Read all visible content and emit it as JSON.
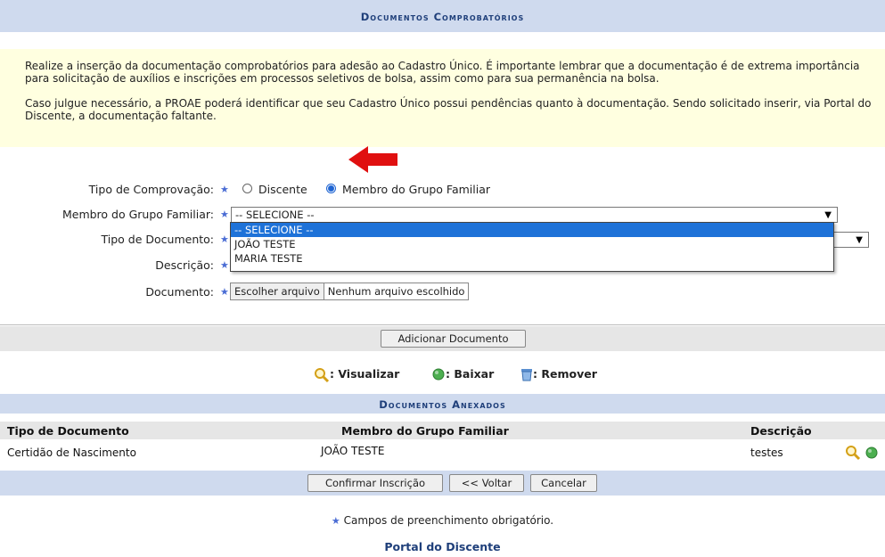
{
  "header": {
    "title": "Documentos Comprobatórios"
  },
  "notice": {
    "p1": "Realize a inserção da documentação comprobatórios para adesão ao Cadastro Único. É importante lembrar que a documentação é de extrema importância para solicitação de auxílios e inscrições em processos seletivos de bolsa, assim como para sua permanência na bolsa.",
    "p2": "Caso julgue necessário, a PROAE poderá identificar que seu Cadastro Único possui pendências quanto à documentação. Sendo solicitado inserir, via Portal do Discente, a documentação faltante."
  },
  "form": {
    "tipo_comprovacao_label": "Tipo de Comprovação:",
    "radio_discente": "Discente",
    "radio_membro": "Membro do Grupo Familiar",
    "membro_label": "Membro do Grupo Familiar:",
    "membro_value": "-- SELECIONE --",
    "membro_options": [
      "-- SELECIONE --",
      "JOÃO TESTE",
      "MARIA TESTE"
    ],
    "tipo_doc_label": "Tipo de Documento:",
    "descricao_label": "Descrição:",
    "documento_label": "Documento:",
    "choose_file": "Escolher arquivo",
    "no_file": "Nenhum arquivo escolhido",
    "add_button": "Adicionar Documento",
    "required_star": "★"
  },
  "legend": {
    "visualizar": ": Visualizar",
    "baixar": ": Baixar",
    "remover": ": Remover"
  },
  "attached": {
    "title": "Documentos Anexados",
    "headers": [
      "Tipo de Documento",
      "Membro do Grupo Familiar",
      "Descrição"
    ],
    "rows": [
      {
        "tipo": "Certidão de Nascimento",
        "membro": "JOÃO TESTE",
        "descricao": "testes"
      }
    ]
  },
  "actions": {
    "confirm": "Confirmar Inscrição",
    "back": "<< Voltar",
    "cancel": "Cancelar"
  },
  "footer": {
    "required_note": "Campos de preenchimento obrigatório.",
    "portal_link": "Portal do Discente"
  },
  "colors": {
    "header_bg": "#cfdaee",
    "notice_bg": "#ffffe0",
    "accent": "#1f3f7a",
    "arrow": "#e01010"
  }
}
